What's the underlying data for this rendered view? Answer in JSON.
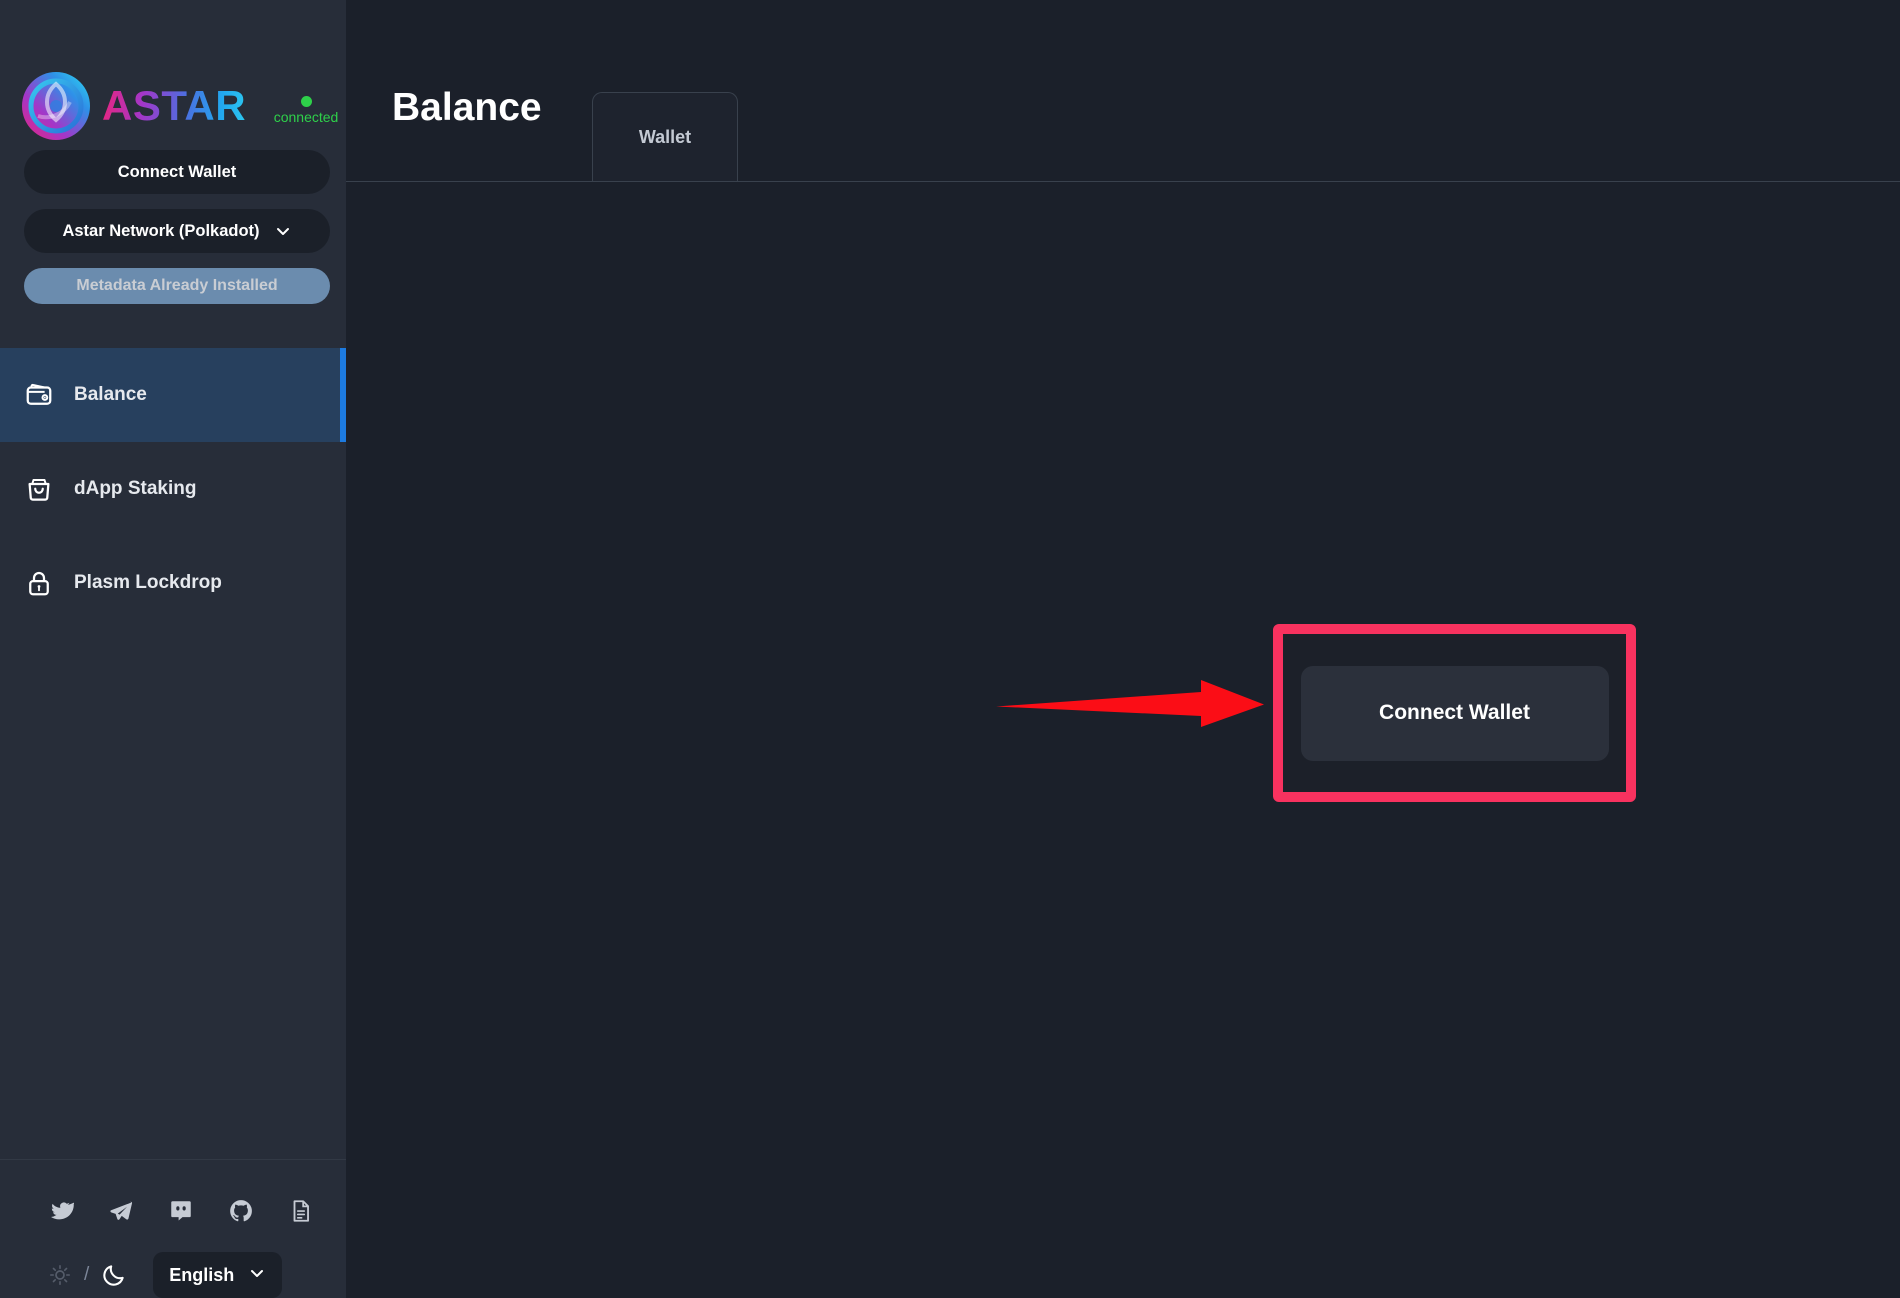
{
  "app": {
    "brand_name": "ASTAR",
    "brand_gradient": [
      "#e9257e",
      "#a436c8",
      "#4b6fe0",
      "#2cc8f0"
    ],
    "connection_status": "connected",
    "connection_color": "#2ed04a",
    "logo_icon": "astar-logo-icon"
  },
  "sidebar": {
    "connect_wallet_label": "Connect Wallet",
    "network": {
      "label": "Astar Network (Polkadot)",
      "chevron_icon": "chevron-down-icon"
    },
    "metadata_button": {
      "label": "Metadata Already Installed",
      "disabled": true,
      "bg_color": "#6b8cae"
    },
    "nav_items": [
      {
        "label": "Balance",
        "icon": "wallet-icon",
        "active": true,
        "accent_color": "#1d7be0"
      },
      {
        "label": "dApp Staking",
        "icon": "bag-icon",
        "active": false
      },
      {
        "label": "Plasm Lockdrop",
        "icon": "lock-icon",
        "active": false
      }
    ],
    "footer": {
      "social": [
        {
          "name": "twitter-icon",
          "title": "Twitter"
        },
        {
          "name": "telegram-icon",
          "title": "Telegram"
        },
        {
          "name": "discord-icon",
          "title": "Discord"
        },
        {
          "name": "github-icon",
          "title": "GitHub"
        },
        {
          "name": "docs-icon",
          "title": "Docs"
        }
      ],
      "theme": {
        "light_icon": "sun-icon",
        "separator": "/",
        "dark_icon": "moon-icon",
        "active": "dark"
      },
      "language": {
        "label": "English",
        "chevron_icon": "chevron-down-icon"
      }
    }
  },
  "main": {
    "page_title": "Balance",
    "tabs": [
      {
        "label": "Wallet",
        "active": true
      }
    ],
    "wallet_panel": {
      "connect_button_label": "Connect Wallet",
      "highlight_color": "#f8325f",
      "card_bg": "#1c2029",
      "button_bg": "#2b303b"
    },
    "annotation": {
      "arrow_color": "#fb0d16",
      "arrow_direction": "right",
      "points_to": "connect-wallet-button"
    }
  }
}
